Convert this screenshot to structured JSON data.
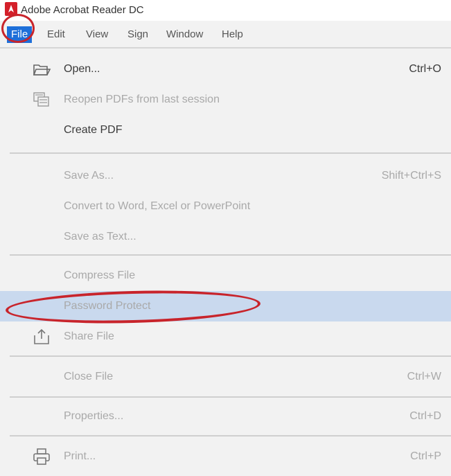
{
  "window": {
    "title": "Adobe Acrobat Reader DC"
  },
  "menubar": {
    "items": [
      "File",
      "Edit",
      "View",
      "Sign",
      "Window",
      "Help"
    ],
    "active": "File"
  },
  "file_menu": {
    "items": [
      {
        "label": "Open...",
        "shortcut": "Ctrl+O",
        "icon": "open-folder-icon",
        "state": "enabled"
      },
      {
        "label": "Reopen PDFs from last session",
        "shortcut": "",
        "icon": "reopen-documents-icon",
        "state": "disabled"
      },
      {
        "label": "Create PDF",
        "shortcut": "",
        "icon": "",
        "state": "enabled"
      },
      {
        "label": "Save As...",
        "shortcut": "Shift+Ctrl+S",
        "icon": "",
        "state": "disabled"
      },
      {
        "label": "Convert to Word, Excel or PowerPoint",
        "shortcut": "",
        "icon": "",
        "state": "disabled"
      },
      {
        "label": "Save as Text...",
        "shortcut": "",
        "icon": "",
        "state": "disabled"
      },
      {
        "label": "Compress File",
        "shortcut": "",
        "icon": "",
        "state": "disabled"
      },
      {
        "label": "Password Protect",
        "shortcut": "",
        "icon": "",
        "state": "disabled",
        "highlighted": true
      },
      {
        "label": "Share File",
        "shortcut": "",
        "icon": "share-icon",
        "state": "disabled"
      },
      {
        "label": "Close File",
        "shortcut": "Ctrl+W",
        "icon": "",
        "state": "disabled"
      },
      {
        "label": "Properties...",
        "shortcut": "Ctrl+D",
        "icon": "",
        "state": "disabled"
      },
      {
        "label": "Print...",
        "shortcut": "Ctrl+P",
        "icon": "printer-icon",
        "state": "disabled"
      }
    ]
  },
  "colors": {
    "annotation": "#c8242b",
    "active_menu": "#1e6fd9",
    "highlight_row": "#c9d9ee"
  }
}
